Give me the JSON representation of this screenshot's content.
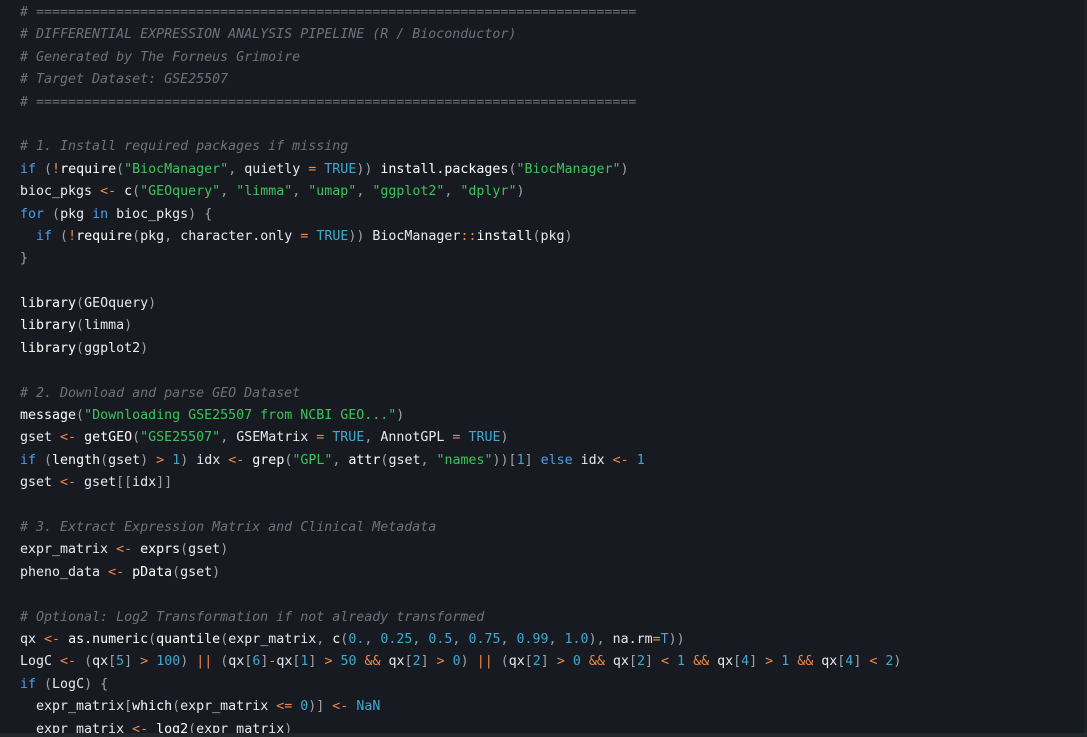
{
  "editor": {
    "language": "R",
    "lines": [
      [
        [
          "c",
          "# ==========================================================================="
        ]
      ],
      [
        [
          "c",
          "# DIFFERENTIAL EXPRESSION ANALYSIS PIPELINE (R / Bioconductor)"
        ]
      ],
      [
        [
          "c",
          "# Generated by The Forneus Grimoire"
        ]
      ],
      [
        [
          "c",
          "# Target Dataset: GSE25507"
        ]
      ],
      [
        [
          "c",
          "# ==========================================================================="
        ]
      ],
      [],
      [
        [
          "c",
          "# 1. Install required packages if missing"
        ]
      ],
      [
        [
          "k",
          "if"
        ],
        [
          "t",
          " "
        ],
        [
          "p",
          "("
        ],
        [
          "o",
          "!"
        ],
        [
          "f",
          "require"
        ],
        [
          "p",
          "("
        ],
        [
          "s",
          "\"BiocManager\""
        ],
        [
          "p",
          ", "
        ],
        [
          "t",
          "quietly "
        ],
        [
          "o",
          "="
        ],
        [
          "t",
          " "
        ],
        [
          "n",
          "TRUE"
        ],
        [
          "p",
          "))"
        ],
        [
          "t",
          " "
        ],
        [
          "f",
          "install.packages"
        ],
        [
          "p",
          "("
        ],
        [
          "s",
          "\"BiocManager\""
        ],
        [
          "p",
          ")"
        ]
      ],
      [
        [
          "t",
          "bioc_pkgs "
        ],
        [
          "o",
          "<-"
        ],
        [
          "t",
          " "
        ],
        [
          "f",
          "c"
        ],
        [
          "p",
          "("
        ],
        [
          "s",
          "\"GEOquery\""
        ],
        [
          "p",
          ", "
        ],
        [
          "s",
          "\"limma\""
        ],
        [
          "p",
          ", "
        ],
        [
          "s",
          "\"umap\""
        ],
        [
          "p",
          ", "
        ],
        [
          "s",
          "\"ggplot2\""
        ],
        [
          "p",
          ", "
        ],
        [
          "s",
          "\"dplyr\""
        ],
        [
          "p",
          ")"
        ]
      ],
      [
        [
          "k",
          "for"
        ],
        [
          "t",
          " "
        ],
        [
          "p",
          "("
        ],
        [
          "t",
          "pkg "
        ],
        [
          "k",
          "in"
        ],
        [
          "t",
          " bioc_pkgs"
        ],
        [
          "p",
          ")"
        ],
        [
          "t",
          " "
        ],
        [
          "p",
          "{"
        ]
      ],
      [
        [
          "t",
          "  "
        ],
        [
          "k",
          "if"
        ],
        [
          "t",
          " "
        ],
        [
          "p",
          "("
        ],
        [
          "o",
          "!"
        ],
        [
          "f",
          "require"
        ],
        [
          "p",
          "("
        ],
        [
          "t",
          "pkg"
        ],
        [
          "p",
          ", "
        ],
        [
          "t",
          "character.only "
        ],
        [
          "o",
          "="
        ],
        [
          "t",
          " "
        ],
        [
          "n",
          "TRUE"
        ],
        [
          "p",
          "))"
        ],
        [
          "t",
          " BiocManager"
        ],
        [
          "o",
          "::"
        ],
        [
          "f",
          "install"
        ],
        [
          "p",
          "("
        ],
        [
          "t",
          "pkg"
        ],
        [
          "p",
          ")"
        ]
      ],
      [
        [
          "p",
          "}"
        ]
      ],
      [],
      [
        [
          "f",
          "library"
        ],
        [
          "p",
          "("
        ],
        [
          "t",
          "GEOquery"
        ],
        [
          "p",
          ")"
        ]
      ],
      [
        [
          "f",
          "library"
        ],
        [
          "p",
          "("
        ],
        [
          "t",
          "limma"
        ],
        [
          "p",
          ")"
        ]
      ],
      [
        [
          "f",
          "library"
        ],
        [
          "p",
          "("
        ],
        [
          "t",
          "ggplot2"
        ],
        [
          "p",
          ")"
        ]
      ],
      [],
      [
        [
          "c",
          "# 2. Download and parse GEO Dataset"
        ]
      ],
      [
        [
          "f",
          "message"
        ],
        [
          "p",
          "("
        ],
        [
          "s",
          "\"Downloading GSE25507 from NCBI GEO...\""
        ],
        [
          "p",
          ")"
        ]
      ],
      [
        [
          "t",
          "gset "
        ],
        [
          "o",
          "<-"
        ],
        [
          "t",
          " "
        ],
        [
          "f",
          "getGEO"
        ],
        [
          "p",
          "("
        ],
        [
          "s",
          "\"GSE25507\""
        ],
        [
          "p",
          ", "
        ],
        [
          "t",
          "GSEMatrix "
        ],
        [
          "o",
          "="
        ],
        [
          "t",
          " "
        ],
        [
          "n",
          "TRUE"
        ],
        [
          "p",
          ", "
        ],
        [
          "t",
          "AnnotGPL "
        ],
        [
          "o",
          "="
        ],
        [
          "t",
          " "
        ],
        [
          "n",
          "TRUE"
        ],
        [
          "p",
          ")"
        ]
      ],
      [
        [
          "k",
          "if"
        ],
        [
          "t",
          " "
        ],
        [
          "p",
          "("
        ],
        [
          "f",
          "length"
        ],
        [
          "p",
          "("
        ],
        [
          "t",
          "gset"
        ],
        [
          "p",
          ")"
        ],
        [
          "t",
          " "
        ],
        [
          "o",
          ">"
        ],
        [
          "t",
          " "
        ],
        [
          "n",
          "1"
        ],
        [
          "p",
          ")"
        ],
        [
          "t",
          " idx "
        ],
        [
          "o",
          "<-"
        ],
        [
          "t",
          " "
        ],
        [
          "f",
          "grep"
        ],
        [
          "p",
          "("
        ],
        [
          "s",
          "\"GPL\""
        ],
        [
          "p",
          ", "
        ],
        [
          "f",
          "attr"
        ],
        [
          "p",
          "("
        ],
        [
          "t",
          "gset"
        ],
        [
          "p",
          ", "
        ],
        [
          "s",
          "\"names\""
        ],
        [
          "p",
          "))["
        ],
        [
          "n",
          "1"
        ],
        [
          "p",
          "]"
        ],
        [
          "t",
          " "
        ],
        [
          "k",
          "else"
        ],
        [
          "t",
          " idx "
        ],
        [
          "o",
          "<-"
        ],
        [
          "t",
          " "
        ],
        [
          "n",
          "1"
        ]
      ],
      [
        [
          "t",
          "gset "
        ],
        [
          "o",
          "<-"
        ],
        [
          "t",
          " gset"
        ],
        [
          "p",
          "[["
        ],
        [
          "t",
          "idx"
        ],
        [
          "p",
          "]]"
        ]
      ],
      [],
      [
        [
          "c",
          "# 3. Extract Expression Matrix and Clinical Metadata"
        ]
      ],
      [
        [
          "t",
          "expr_matrix "
        ],
        [
          "o",
          "<-"
        ],
        [
          "t",
          " "
        ],
        [
          "f",
          "exprs"
        ],
        [
          "p",
          "("
        ],
        [
          "t",
          "gset"
        ],
        [
          "p",
          ")"
        ]
      ],
      [
        [
          "t",
          "pheno_data "
        ],
        [
          "o",
          "<-"
        ],
        [
          "t",
          " "
        ],
        [
          "f",
          "pData"
        ],
        [
          "p",
          "("
        ],
        [
          "t",
          "gset"
        ],
        [
          "p",
          ")"
        ]
      ],
      [],
      [
        [
          "c",
          "# Optional: Log2 Transformation if not already transformed"
        ]
      ],
      [
        [
          "t",
          "qx "
        ],
        [
          "o",
          "<-"
        ],
        [
          "t",
          " "
        ],
        [
          "f",
          "as.numeric"
        ],
        [
          "p",
          "("
        ],
        [
          "f",
          "quantile"
        ],
        [
          "p",
          "("
        ],
        [
          "t",
          "expr_matrix"
        ],
        [
          "p",
          ", "
        ],
        [
          "f",
          "c"
        ],
        [
          "p",
          "("
        ],
        [
          "n",
          "0."
        ],
        [
          "p",
          ", "
        ],
        [
          "n",
          "0.25"
        ],
        [
          "p",
          ", "
        ],
        [
          "n",
          "0.5"
        ],
        [
          "p",
          ", "
        ],
        [
          "n",
          "0.75"
        ],
        [
          "p",
          ", "
        ],
        [
          "n",
          "0.99"
        ],
        [
          "p",
          ", "
        ],
        [
          "n",
          "1.0"
        ],
        [
          "p",
          "), "
        ],
        [
          "t",
          "na.rm"
        ],
        [
          "o",
          "="
        ],
        [
          "n",
          "T"
        ],
        [
          "p",
          "))"
        ]
      ],
      [
        [
          "t",
          "LogC "
        ],
        [
          "o",
          "<-"
        ],
        [
          "t",
          " "
        ],
        [
          "p",
          "("
        ],
        [
          "t",
          "qx"
        ],
        [
          "p",
          "["
        ],
        [
          "n",
          "5"
        ],
        [
          "p",
          "]"
        ],
        [
          "t",
          " "
        ],
        [
          "o",
          ">"
        ],
        [
          "t",
          " "
        ],
        [
          "n",
          "100"
        ],
        [
          "p",
          ")"
        ],
        [
          "t",
          " "
        ],
        [
          "o",
          "||"
        ],
        [
          "t",
          " "
        ],
        [
          "p",
          "("
        ],
        [
          "t",
          "qx"
        ],
        [
          "p",
          "["
        ],
        [
          "n",
          "6"
        ],
        [
          "p",
          "]"
        ],
        [
          "o",
          "-"
        ],
        [
          "t",
          "qx"
        ],
        [
          "p",
          "["
        ],
        [
          "n",
          "1"
        ],
        [
          "p",
          "]"
        ],
        [
          "t",
          " "
        ],
        [
          "o",
          ">"
        ],
        [
          "t",
          " "
        ],
        [
          "n",
          "50"
        ],
        [
          "t",
          " "
        ],
        [
          "o",
          "&&"
        ],
        [
          "t",
          " qx"
        ],
        [
          "p",
          "["
        ],
        [
          "n",
          "2"
        ],
        [
          "p",
          "]"
        ],
        [
          "t",
          " "
        ],
        [
          "o",
          ">"
        ],
        [
          "t",
          " "
        ],
        [
          "n",
          "0"
        ],
        [
          "p",
          ")"
        ],
        [
          "t",
          " "
        ],
        [
          "o",
          "||"
        ],
        [
          "t",
          " "
        ],
        [
          "p",
          "("
        ],
        [
          "t",
          "qx"
        ],
        [
          "p",
          "["
        ],
        [
          "n",
          "2"
        ],
        [
          "p",
          "]"
        ],
        [
          "t",
          " "
        ],
        [
          "o",
          ">"
        ],
        [
          "t",
          " "
        ],
        [
          "n",
          "0"
        ],
        [
          "t",
          " "
        ],
        [
          "o",
          "&&"
        ],
        [
          "t",
          " qx"
        ],
        [
          "p",
          "["
        ],
        [
          "n",
          "2"
        ],
        [
          "p",
          "]"
        ],
        [
          "t",
          " "
        ],
        [
          "o",
          "<"
        ],
        [
          "t",
          " "
        ],
        [
          "n",
          "1"
        ],
        [
          "t",
          " "
        ],
        [
          "o",
          "&&"
        ],
        [
          "t",
          " qx"
        ],
        [
          "p",
          "["
        ],
        [
          "n",
          "4"
        ],
        [
          "p",
          "]"
        ],
        [
          "t",
          " "
        ],
        [
          "o",
          ">"
        ],
        [
          "t",
          " "
        ],
        [
          "n",
          "1"
        ],
        [
          "t",
          " "
        ],
        [
          "o",
          "&&"
        ],
        [
          "t",
          " qx"
        ],
        [
          "p",
          "["
        ],
        [
          "n",
          "4"
        ],
        [
          "p",
          "]"
        ],
        [
          "t",
          " "
        ],
        [
          "o",
          "<"
        ],
        [
          "t",
          " "
        ],
        [
          "n",
          "2"
        ],
        [
          "p",
          ")"
        ]
      ],
      [
        [
          "k",
          "if"
        ],
        [
          "t",
          " "
        ],
        [
          "p",
          "("
        ],
        [
          "t",
          "LogC"
        ],
        [
          "p",
          ")"
        ],
        [
          "t",
          " "
        ],
        [
          "p",
          "{"
        ]
      ],
      [
        [
          "t",
          "  expr_matrix"
        ],
        [
          "p",
          "["
        ],
        [
          "f",
          "which"
        ],
        [
          "p",
          "("
        ],
        [
          "t",
          "expr_matrix "
        ],
        [
          "o",
          "<="
        ],
        [
          "t",
          " "
        ],
        [
          "n",
          "0"
        ],
        [
          "p",
          ")]"
        ],
        [
          "t",
          " "
        ],
        [
          "o",
          "<-"
        ],
        [
          "t",
          " "
        ],
        [
          "n",
          "NaN"
        ]
      ],
      [
        [
          "t",
          "  expr_matrix "
        ],
        [
          "o",
          "<-"
        ],
        [
          "t",
          " "
        ],
        [
          "f",
          "log2"
        ],
        [
          "p",
          "("
        ],
        [
          "t",
          "expr_matrix"
        ],
        [
          "p",
          ")"
        ]
      ]
    ]
  }
}
